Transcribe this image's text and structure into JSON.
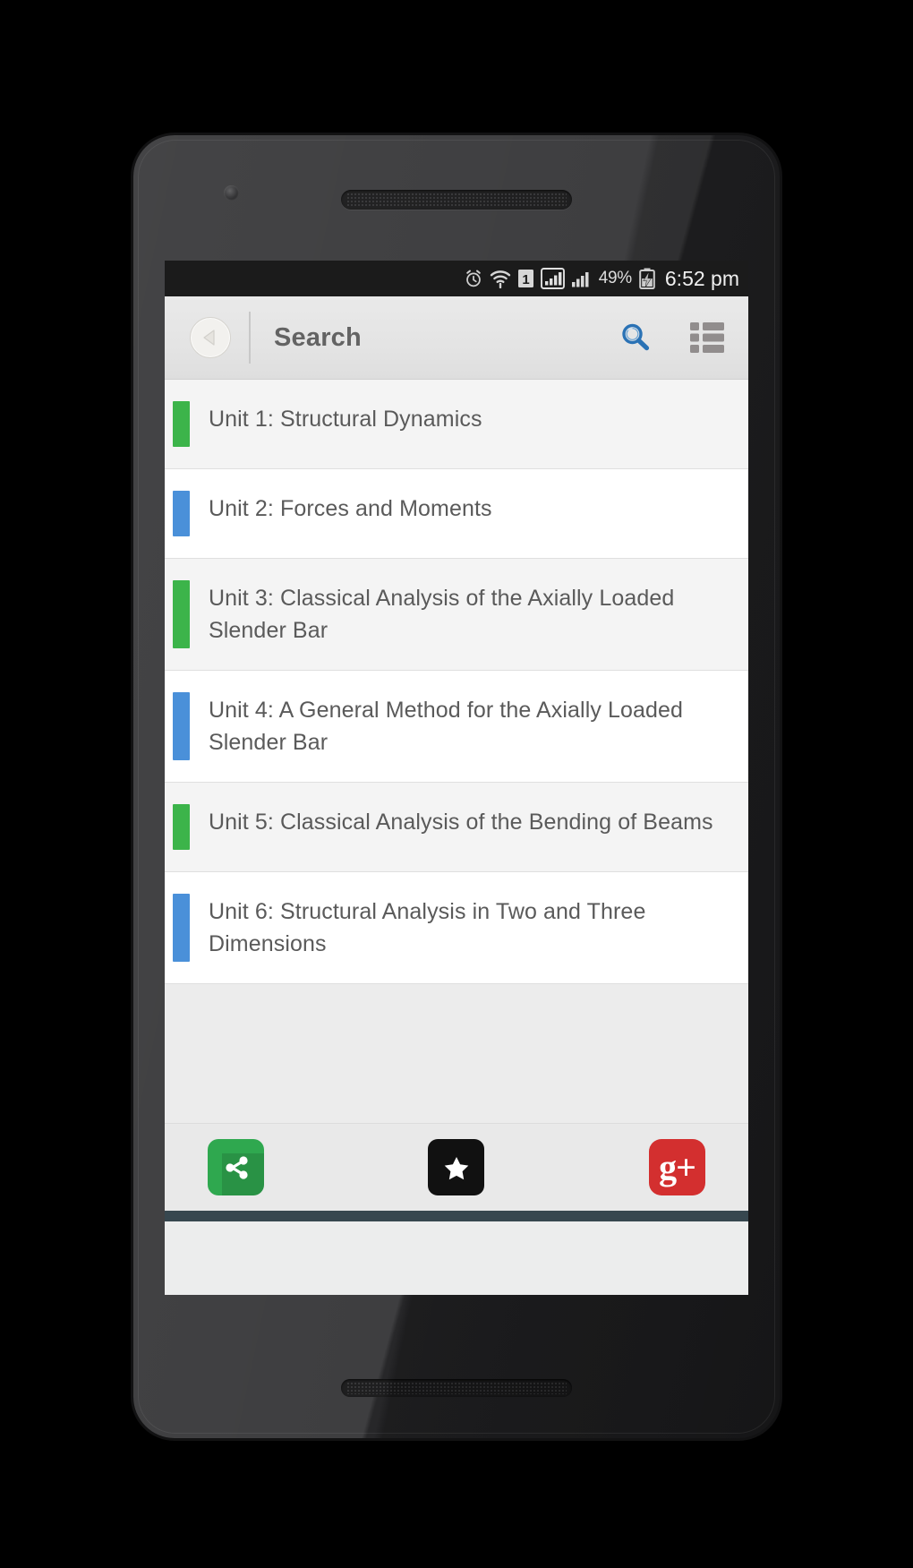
{
  "device": {
    "frame": "android-phone",
    "camera_icon": "front-camera",
    "earpiece_icon": "earpiece-speaker",
    "bottom_speaker_icon": "bottom-speaker"
  },
  "status_bar": {
    "icons": [
      "alarm-icon",
      "wifi-icon",
      "sim-1-icon",
      "signal-bars-icon",
      "signal-bars-2-icon"
    ],
    "battery_percent": "49%",
    "battery_icon": "battery-charging-icon",
    "time": "6:52 pm"
  },
  "app_bar": {
    "back_label": "back-arrow",
    "title": "Search",
    "actions": [
      {
        "name": "search-icon",
        "color": "#2a72b5"
      },
      {
        "name": "list-view-icon",
        "color": "#8f8b8b"
      }
    ]
  },
  "list": {
    "items": [
      {
        "label": "Unit 1: Structural Dynamics",
        "accent": "#3cb44a",
        "row_bg": "#f4f4f4"
      },
      {
        "label": "Unit 2: Forces and Moments",
        "accent": "#4a90d9",
        "row_bg": "#ffffff"
      },
      {
        "label": "Unit 3: Classical Analysis of the Axially Loaded Slender Bar",
        "accent": "#3cb44a",
        "row_bg": "#f4f4f4"
      },
      {
        "label": "Unit 4: A General Method for the Axially Loaded Slender Bar",
        "accent": "#4a90d9",
        "row_bg": "#ffffff"
      },
      {
        "label": "Unit 5: Classical Analysis of the Bending of Beams",
        "accent": "#3cb44a",
        "row_bg": "#f4f4f4"
      },
      {
        "label": "Unit 6: Structural Analysis in Two and Three Dimensions",
        "accent": "#4a90d9",
        "row_bg": "#ffffff"
      }
    ]
  },
  "bottom_bar": {
    "buttons": [
      {
        "name": "share-button",
        "icon": "share-icon",
        "color": "#2fa84f"
      },
      {
        "name": "rate-button",
        "icon": "star-icon",
        "color": "#111111"
      },
      {
        "name": "google-plus-button",
        "icon": "google-plus-icon",
        "label": "g+",
        "color": "#d32f2f"
      }
    ]
  },
  "colors": {
    "accent_green": "#3cb44a",
    "accent_blue": "#4a90d9",
    "appbar_bg": "#e6e6e6",
    "search_blue": "#2a72b5",
    "navbar": "#37474f"
  }
}
